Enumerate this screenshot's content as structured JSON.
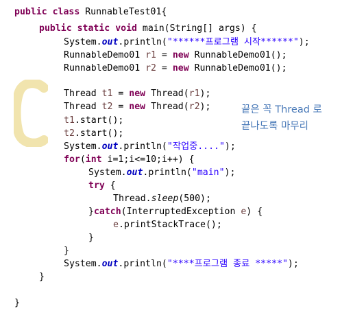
{
  "code": {
    "l1": {
      "kw1": "public",
      "kw2": "class",
      "text": " RunnableTest01{"
    },
    "l2": {
      "kw1": "public",
      "kw2": "static",
      "kw3": "void",
      "text": " main(String[] args) {"
    },
    "l3": {
      "pre": "System.",
      "fld": "out",
      "mid": ".println(",
      "str": "\"******프로그램 시작******\"",
      "post": ");"
    },
    "l4": {
      "pre": "RunnableDemo01 ",
      "var": "r1",
      "mid": " = ",
      "kw": "new",
      "post": " RunnableDemo01();"
    },
    "l5": {
      "pre": "RunnableDemo01 ",
      "var": "r2",
      "mid": " = ",
      "kw": "new",
      "post": " RunnableDemo01();"
    },
    "l6": {
      "pre": "Thread ",
      "var": "t1",
      "mid": " = ",
      "kw": "new",
      "mid2": " Thread(",
      "arg": "r1",
      "post": ");"
    },
    "l7": {
      "pre": "Thread ",
      "var": "t2",
      "mid": " = ",
      "kw": "new",
      "mid2": " Thread(",
      "arg": "r2",
      "post": ");"
    },
    "l8": {
      "var": "t1",
      "post": ".start();"
    },
    "l9": {
      "var": "t2",
      "post": ".start();"
    },
    "l10": {
      "pre": "System.",
      "fld": "out",
      "mid": ".println(",
      "str": "\"작업중....\"",
      "post": ");"
    },
    "l11": {
      "kw": "for",
      "mid": "(",
      "kw2": "int",
      "post": " i=1;i<=10;i++) {"
    },
    "l12": {
      "pre": "System.",
      "fld": "out",
      "mid": ".println(",
      "str": "\"main\"",
      "post": ");"
    },
    "l13": {
      "kw": "try",
      "post": " {"
    },
    "l14": {
      "pre": "Thread.",
      "smeth": "sleep",
      "post": "(500);"
    },
    "l15": {
      "pre": "}",
      "kw": "catch",
      "mid": "(InterruptedException ",
      "var": "e",
      "post": ") {"
    },
    "l16": {
      "var": "e",
      "post": ".printStackTrace();"
    },
    "l17": {
      "text": "}"
    },
    "l18": {
      "text": "}"
    },
    "l19": {
      "pre": "System.",
      "fld": "out",
      "mid": ".println(",
      "str": "\"****프로그램 종료 *****\"",
      "post": ");"
    },
    "l20": {
      "text": "}"
    },
    "l21": {
      "text": "}"
    }
  },
  "annotation": {
    "line1": "끝은 꼭 Thread 로",
    "line2": "끝나도록 마무리"
  },
  "colors": {
    "keyword": "#7f0055",
    "field": "#0000c0",
    "variable": "#6a3e3e",
    "string": "#2a00ff",
    "annotation": "#4a7ab8",
    "highlight": "#eedfa0"
  }
}
